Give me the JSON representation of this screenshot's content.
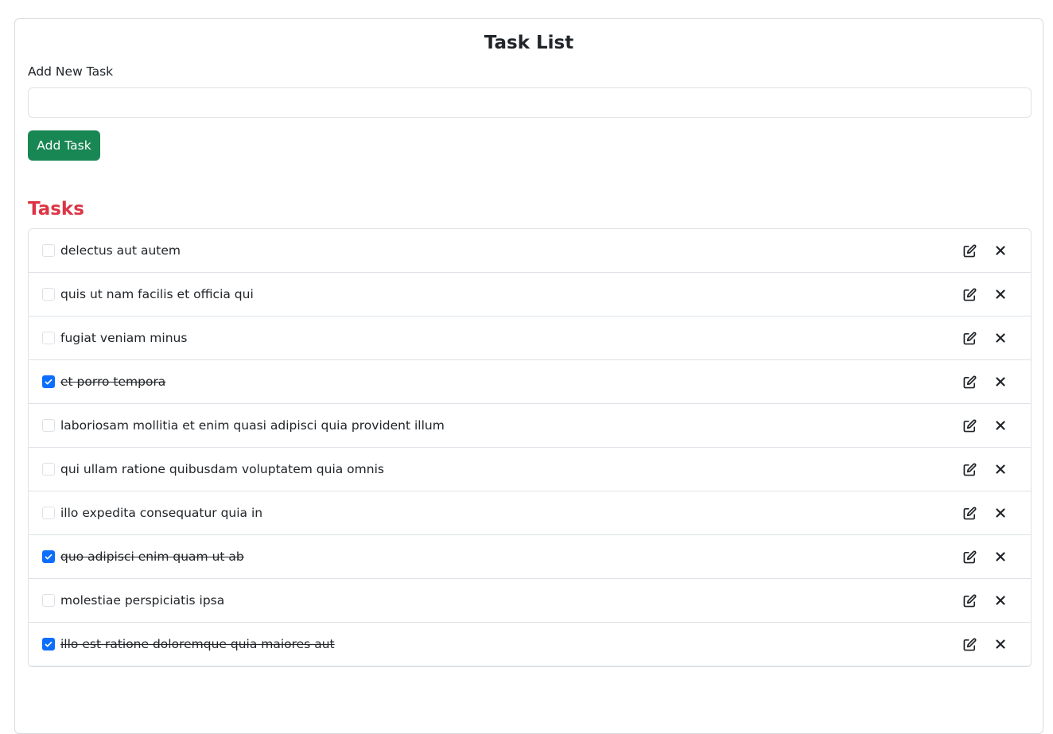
{
  "header": {
    "title": "Task List"
  },
  "form": {
    "label": "Add New Task",
    "input_value": "",
    "placeholder": "",
    "button_label": "Add Task"
  },
  "tasks_section": {
    "heading": "Tasks",
    "items": [
      {
        "text": "delectus aut autem",
        "completed": false
      },
      {
        "text": "quis ut nam facilis et officia qui",
        "completed": false
      },
      {
        "text": "fugiat veniam minus",
        "completed": false
      },
      {
        "text": "et porro tempora",
        "completed": true
      },
      {
        "text": "laboriosam mollitia et enim quasi adipisci quia provident illum",
        "completed": false
      },
      {
        "text": "qui ullam ratione quibusdam voluptatem quia omnis",
        "completed": false
      },
      {
        "text": "illo expedita consequatur quia in",
        "completed": false
      },
      {
        "text": "quo adipisci enim quam ut ab",
        "completed": true
      },
      {
        "text": "molestiae perspiciatis ipsa",
        "completed": false
      },
      {
        "text": "illo est ratione doloremque quia maiores aut",
        "completed": true
      }
    ]
  },
  "icons": {
    "edit": "edit-icon",
    "delete": "close-icon"
  },
  "colors": {
    "add_button": "#198754",
    "tasks_heading": "#dc3545",
    "checkbox_checked": "#0d6efd"
  }
}
